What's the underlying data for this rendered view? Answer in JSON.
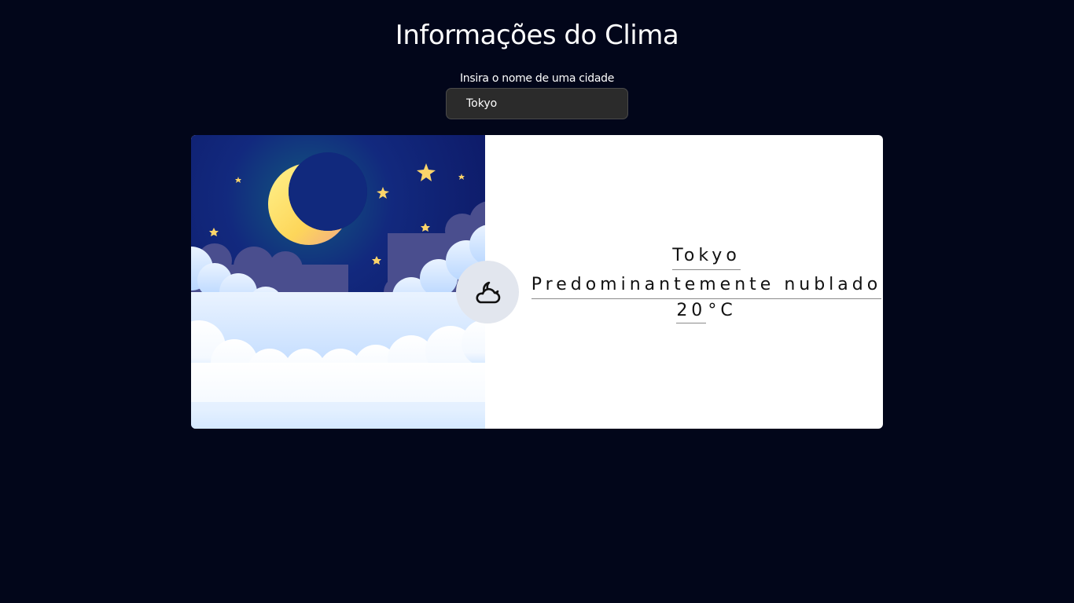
{
  "header": {
    "title": "Informações do Clima"
  },
  "search": {
    "label": "Insira o nome de uma cidade",
    "value": "Tokyo"
  },
  "weather": {
    "city": "Tokyo",
    "description": "Predominantemente nublado",
    "temperature": "20",
    "unit": "°C",
    "icon": "cloud-moon-icon",
    "scene": "night-sky-moon-clouds"
  },
  "colors": {
    "background": "#02061a",
    "card": "#ffffff",
    "input_bg": "#2b2b2b",
    "icon_badge": "#e2e6ee",
    "sky_dark": "#101a6e",
    "moon": "#fdd85a"
  }
}
